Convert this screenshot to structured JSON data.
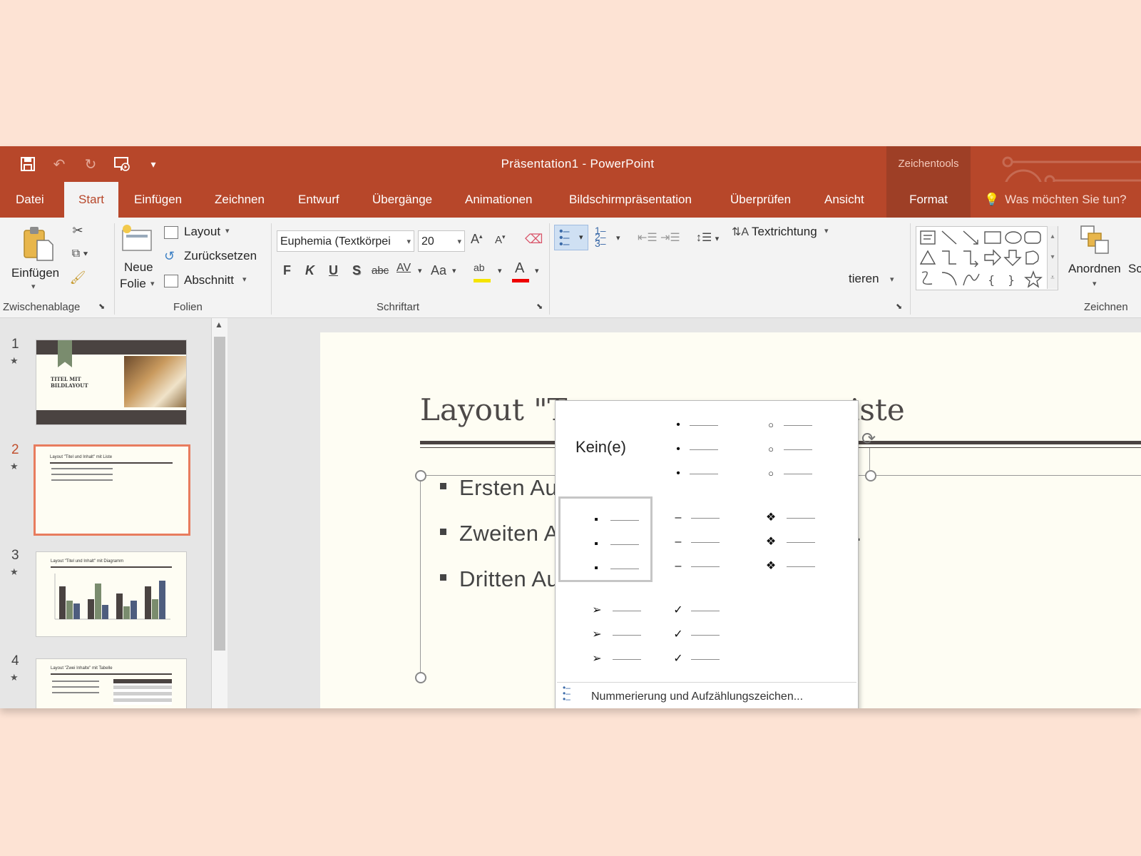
{
  "titlebar": {
    "title": "Präsentation1  -  PowerPoint",
    "contextual_group": "Zeichentools"
  },
  "tabs": [
    "Datei",
    "Start",
    "Einfügen",
    "Zeichnen",
    "Entwurf",
    "Übergänge",
    "Animationen",
    "Bildschirmpräsentation",
    "Überprüfen",
    "Ansicht",
    "Format"
  ],
  "active_tab": "Start",
  "tell_me": "Was möchten Sie tun?",
  "ribbon": {
    "clipboard": {
      "paste": "Einfügen",
      "group": "Zwischenablage"
    },
    "slides": {
      "new_slide_1": "Neue",
      "new_slide_2": "Folie",
      "layout": "Layout",
      "reset": "Zurücksetzen",
      "section": "Abschnitt",
      "group": "Folien"
    },
    "font": {
      "name": "Euphemia (Textkörpei",
      "size": "20",
      "bold": "F",
      "italic": "K",
      "underline": "U",
      "shadow": "S",
      "strike": "abc",
      "spacing": "AV",
      "case": "Aa",
      "group": "Schriftart"
    },
    "paragraph": {
      "text_direction": "Textrichtung",
      "partial": "tieren"
    },
    "drawing": {
      "arrange": "Anordnen",
      "quick_styles_partial": "Sc",
      "group": "Zeichnen"
    }
  },
  "thumbnails": [
    {
      "num": "1",
      "title": "TITEL MIT BILDLAYOUT"
    },
    {
      "num": "2",
      "title": "Layout \"Titel und Inhalt\" mit Liste"
    },
    {
      "num": "3",
      "title": "Layout \"Titel und Inhalt\" mit Diagramm"
    },
    {
      "num": "4",
      "title": "Layout \"Zwei Inhalte\" mit Tabelle"
    }
  ],
  "current_slide": 2,
  "slide": {
    "title_left": "Layout \"T",
    "title_right": "iste",
    "bullets": [
      {
        "left": "Ersten Auf",
        "right": "."
      },
      {
        "left": "Zweiten Au",
        "right": "n."
      },
      {
        "left": "Dritten Aufzählungspunkt hier einfügen.",
        "right": ""
      }
    ]
  },
  "bullet_dropdown": {
    "none_label": "Kein(e)",
    "library": [
      {
        "name": "none"
      },
      {
        "name": "filled-round",
        "glyph": "•"
      },
      {
        "name": "hollow-round",
        "glyph": "○"
      },
      {
        "name": "filled-square",
        "glyph": "▪",
        "selected": true
      },
      {
        "name": "dash",
        "glyph": "–"
      },
      {
        "name": "star-diamond",
        "glyph": "❖"
      },
      {
        "name": "arrow",
        "glyph": "➢"
      },
      {
        "name": "checkmark",
        "glyph": "✓"
      }
    ],
    "more_link": "Nummerierung und Aufzählungszeichen..."
  },
  "colors": {
    "accent": "#b7472a",
    "contextual": "#9e3f26",
    "selection": "#e87c5e",
    "page_bg": "#fde3d4"
  }
}
